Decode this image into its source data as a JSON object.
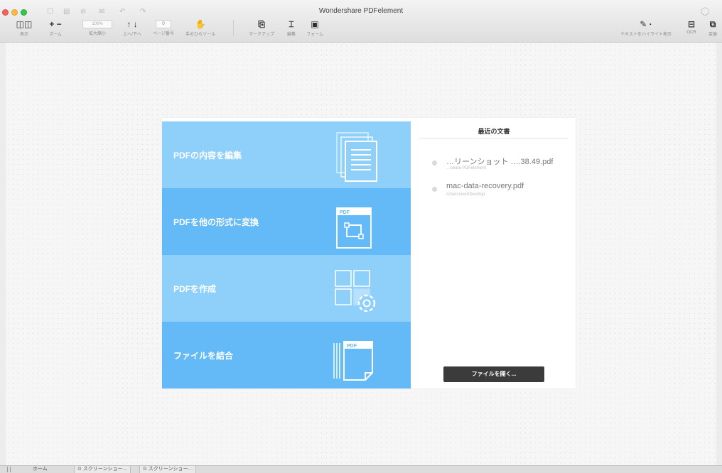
{
  "window": {
    "title": "Wondershare PDFelement"
  },
  "colors": {
    "tile_edit": "#8fd0fb",
    "tile_convert": "#64b9f7",
    "tile_create": "#8fd0fb",
    "tile_combine": "#64b9f7",
    "open_button": "#3b3b3b"
  },
  "toolbar": {
    "left": [
      {
        "icon": "sidebar-toggle-icon",
        "glyph": "◫◫",
        "label": "表示"
      },
      {
        "icon": "zoom-icon",
        "glyph": "+ −",
        "label": "ズーム"
      },
      {
        "icon": "zoom-level-field",
        "value": "100%",
        "label": "拡大縮小"
      },
      {
        "icon": "up-down-icon",
        "glyph": "↑ ↓",
        "label": "上へ/下へ"
      },
      {
        "icon": "page-number-field",
        "value": "0",
        "label": "ページ番号"
      },
      {
        "icon": "hand-icon",
        "glyph": "✋",
        "label": "手のひらツール"
      }
    ],
    "center": [
      {
        "icon": "markup-icon",
        "glyph": "⎘",
        "label": "マークアップ"
      },
      {
        "icon": "edit-icon",
        "glyph": "⌶",
        "label": "編集"
      },
      {
        "icon": "form-icon",
        "glyph": "▣",
        "label": "フォーム"
      }
    ],
    "right": [
      {
        "icon": "highlight-icon",
        "glyph": "✎ ·",
        "label": "テキストをハイライト表示"
      },
      {
        "icon": "ocr-icon",
        "glyph": "⊟",
        "label": "OCR"
      },
      {
        "icon": "convert-icon",
        "glyph": "⧉",
        "label": "変換"
      }
    ]
  },
  "tiles": [
    {
      "label": "PDFの内容を編集",
      "icon": "edit-document-icon"
    },
    {
      "label": "PDFを他の形式に変換",
      "icon": "convert-pdf-icon",
      "badge": "PDF"
    },
    {
      "label": "PDFを作成",
      "icon": "create-pdf-icon"
    },
    {
      "label": "ファイルを結合",
      "icon": "combine-files-icon",
      "badge": "PDF"
    }
  ],
  "recent": {
    "title": "最近の文書",
    "documents": [
      {
        "name": "…リーンショット ….38.49.pdf",
        "path": "…share PDFelement"
      },
      {
        "name": "mac-data-recovery.pdf",
        "path": "/Users/user/Desktop"
      }
    ],
    "open_button": "ファイルを開く..."
  },
  "tabs": [
    {
      "label": "ホーム"
    },
    {
      "label": "⊙ スクリーンショー…"
    },
    {
      "label": "⊙ スクリーンショー…"
    }
  ]
}
